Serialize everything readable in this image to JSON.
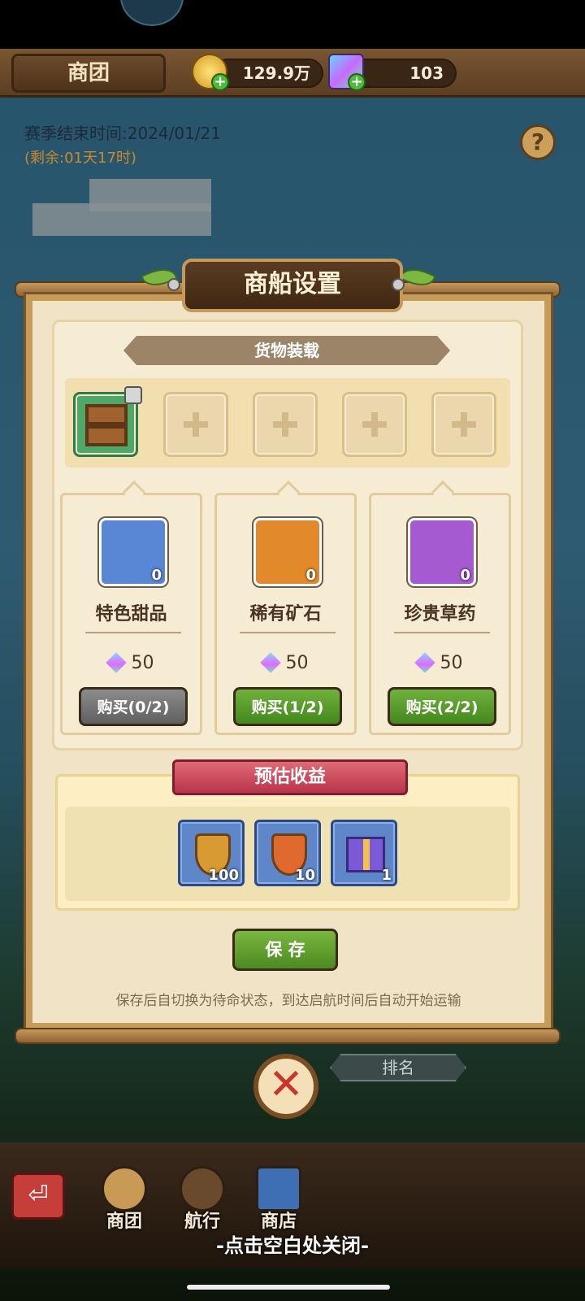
{
  "topbar": {
    "guild_tab": "商团",
    "gold_amount": "129.9万",
    "gem_amount": "103"
  },
  "season": {
    "end_time": "赛季结束时间:2024/01/21",
    "remaining": "(剩余:01天17时)"
  },
  "panel": {
    "title": "商船设置",
    "cargo_label": "货物装载",
    "items": [
      {
        "name": "特色甜品",
        "count": "0",
        "price": "50",
        "buy_label": "购买(0/2)",
        "icon": "cupcake-icon",
        "color": "#5a86d6"
      },
      {
        "name": "稀有矿石",
        "count": "0",
        "price": "50",
        "buy_label": "购买(1/2)",
        "icon": "ore-icon",
        "color": "#e28a2b"
      },
      {
        "name": "珍贵草药",
        "count": "0",
        "price": "50",
        "buy_label": "购买(2/2)",
        "icon": "mushroom-icon",
        "color": "#a55ad1"
      }
    ],
    "income_label": "预估收益",
    "rewards": [
      {
        "icon": "badge-icon",
        "count": "100"
      },
      {
        "icon": "maple-shield-icon",
        "count": "10"
      },
      {
        "icon": "gift-box-icon",
        "count": "1"
      }
    ],
    "save_label": "保 存",
    "save_hint": "保存后自切换为待命状态，到达启航时间后自动开始运输"
  },
  "rank_label": "排名",
  "nav": {
    "guild": "商团",
    "voyage": "航行",
    "shop": "商店"
  },
  "dismiss_hint": "-点击空白处关闭-"
}
